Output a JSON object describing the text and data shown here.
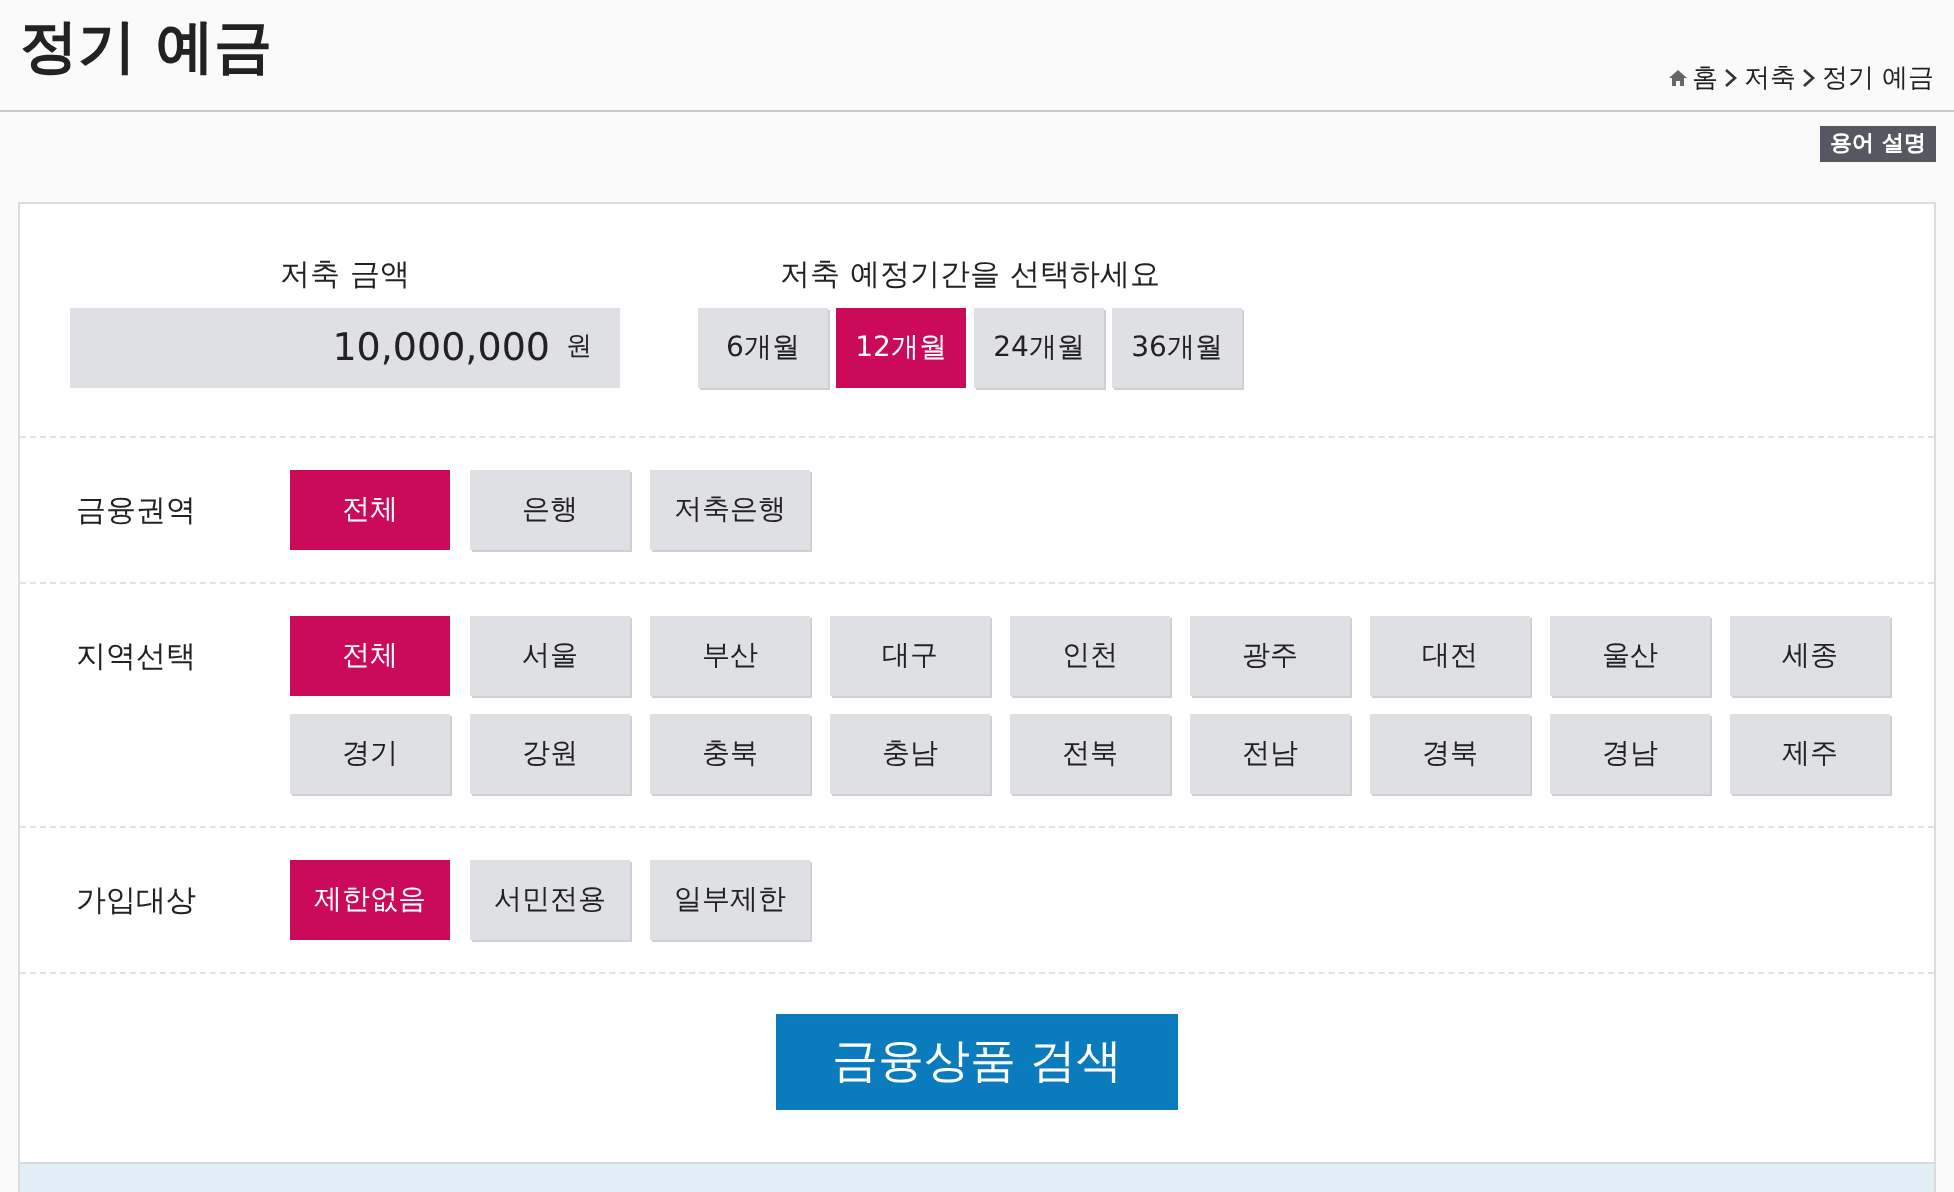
{
  "page_title": "정기 예금",
  "breadcrumb": [
    "홈",
    "저축",
    "정기 예금"
  ],
  "glossary_button": "용어 설명",
  "amount": {
    "label": "저축 금액",
    "value": "10,000,000",
    "unit": "원"
  },
  "period": {
    "label": "저축 예정기간을 선택하세요",
    "options": [
      {
        "label": "6개월",
        "selected": false
      },
      {
        "label": "12개월",
        "selected": true
      },
      {
        "label": "24개월",
        "selected": false
      },
      {
        "label": "36개월",
        "selected": false
      }
    ]
  },
  "filters": [
    {
      "label": "금융권역",
      "options": [
        {
          "label": "전체",
          "selected": true
        },
        {
          "label": "은행",
          "selected": false
        },
        {
          "label": "저축은행",
          "selected": false
        }
      ]
    },
    {
      "label": "지역선택",
      "options": [
        {
          "label": "전체",
          "selected": true
        },
        {
          "label": "서울",
          "selected": false
        },
        {
          "label": "부산",
          "selected": false
        },
        {
          "label": "대구",
          "selected": false
        },
        {
          "label": "인천",
          "selected": false
        },
        {
          "label": "광주",
          "selected": false
        },
        {
          "label": "대전",
          "selected": false
        },
        {
          "label": "울산",
          "selected": false
        },
        {
          "label": "세종",
          "selected": false
        },
        {
          "label": "경기",
          "selected": false
        },
        {
          "label": "강원",
          "selected": false
        },
        {
          "label": "충북",
          "selected": false
        },
        {
          "label": "충남",
          "selected": false
        },
        {
          "label": "전북",
          "selected": false
        },
        {
          "label": "전남",
          "selected": false
        },
        {
          "label": "경북",
          "selected": false
        },
        {
          "label": "경남",
          "selected": false
        },
        {
          "label": "제주",
          "selected": false
        }
      ]
    },
    {
      "label": "가입대상",
      "options": [
        {
          "label": "제한없음",
          "selected": true
        },
        {
          "label": "서민전용",
          "selected": false
        },
        {
          "label": "일부제한",
          "selected": false
        }
      ]
    }
  ],
  "search_button": "금융상품 검색"
}
